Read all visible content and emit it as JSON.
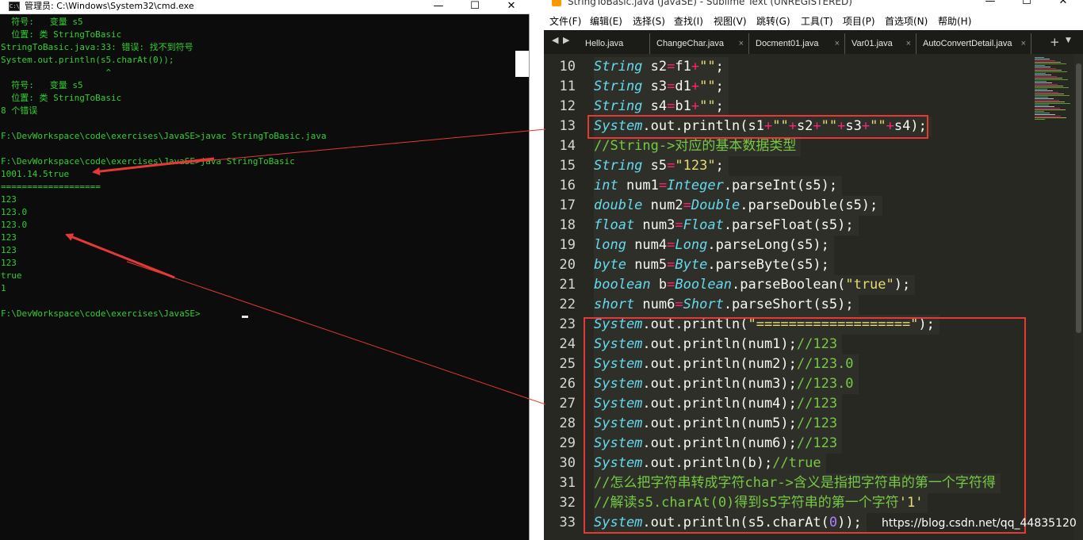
{
  "cmd": {
    "title": "管理员: C:\\Windows\\System32\\cmd.exe",
    "icon": "cmd-icon",
    "minimize": "—",
    "maximize": "☐",
    "close": "✕",
    "lines": [
      "  符号:   变量 s5",
      "  位置: 类 StringToBasic",
      "StringToBasic.java:33: 错误: 找不到符号",
      "System.out.println(s5.charAt(0));",
      "                    ^",
      "  符号:   变量 s5",
      "  位置: 类 StringToBasic",
      "8 个错误",
      "",
      "F:\\DevWorkspace\\code\\exercises\\JavaSE>javac StringToBasic.java",
      "",
      "F:\\DevWorkspace\\code\\exercises\\JavaSE>java StringToBasic",
      "1001.14.5true",
      "===================",
      "123",
      "123.0",
      "123.0",
      "123",
      "123",
      "123",
      "true",
      "1",
      "",
      "F:\\DevWorkspace\\code\\exercises\\JavaSE>"
    ]
  },
  "sublime": {
    "title": "StringToBasic.java (JavaSE) - Sublime Text (UNREGISTERED)",
    "minimize": "—",
    "maximize": "☐",
    "close": "✕",
    "menu": [
      "文件(F)",
      "编辑(E)",
      "选择(S)",
      "查找(I)",
      "视图(V)",
      "跳转(G)",
      "工具(T)",
      "项目(P)",
      "首选项(N)",
      "帮助(H)"
    ],
    "tab_nav": [
      "◀",
      "▶"
    ],
    "tabs": [
      "Hello.java",
      "ChangeChar.java",
      "Docment01.java",
      "Var01.java",
      "AutoConvertDetail.java"
    ],
    "tab_close": "×",
    "tab_plus": "+",
    "tab_more": "▼",
    "code": [
      {
        "n": "10",
        "tokens": [
          [
            "type",
            "String"
          ],
          [
            "plain",
            " s2"
          ],
          [
            "op",
            "="
          ],
          [
            "plain",
            "f1"
          ],
          [
            "op",
            "+"
          ],
          [
            "str",
            "\"\""
          ],
          [
            "plain",
            ";"
          ]
        ]
      },
      {
        "n": "11",
        "tokens": [
          [
            "type",
            "String"
          ],
          [
            "plain",
            " s3"
          ],
          [
            "op",
            "="
          ],
          [
            "plain",
            "d1"
          ],
          [
            "op",
            "+"
          ],
          [
            "str",
            "\"\""
          ],
          [
            "plain",
            ";"
          ]
        ]
      },
      {
        "n": "12",
        "tokens": [
          [
            "type",
            "String"
          ],
          [
            "plain",
            " s4"
          ],
          [
            "op",
            "="
          ],
          [
            "plain",
            "b1"
          ],
          [
            "op",
            "+"
          ],
          [
            "str",
            "\"\""
          ],
          [
            "plain",
            ";"
          ]
        ]
      },
      {
        "n": "13",
        "tokens": [
          [
            "type",
            "System"
          ],
          [
            "plain",
            ".out.println(s1"
          ],
          [
            "op",
            "+"
          ],
          [
            "str",
            "\"\""
          ],
          [
            "op",
            "+"
          ],
          [
            "plain",
            "s2"
          ],
          [
            "op",
            "+"
          ],
          [
            "str",
            "\"\""
          ],
          [
            "op",
            "+"
          ],
          [
            "plain",
            "s3"
          ],
          [
            "op",
            "+"
          ],
          [
            "str",
            "\"\""
          ],
          [
            "op",
            "+"
          ],
          [
            "plain",
            "s4);"
          ]
        ]
      },
      {
        "n": "14",
        "tokens": [
          [
            "cmt",
            "//String->对应的基本数据类型"
          ]
        ]
      },
      {
        "n": "15",
        "tokens": [
          [
            "type",
            "String"
          ],
          [
            "plain",
            " s5"
          ],
          [
            "op",
            "="
          ],
          [
            "str",
            "\"123\""
          ],
          [
            "plain",
            ";"
          ]
        ]
      },
      {
        "n": "16",
        "tokens": [
          [
            "type",
            "int"
          ],
          [
            "plain",
            " num1"
          ],
          [
            "op",
            "="
          ],
          [
            "type",
            "Integer"
          ],
          [
            "plain",
            ".parseInt(s5);"
          ]
        ]
      },
      {
        "n": "17",
        "tokens": [
          [
            "type",
            "double"
          ],
          [
            "plain",
            " num2"
          ],
          [
            "op",
            "="
          ],
          [
            "type",
            "Double"
          ],
          [
            "plain",
            ".parseDouble(s5);"
          ]
        ]
      },
      {
        "n": "18",
        "tokens": [
          [
            "type",
            "float"
          ],
          [
            "plain",
            " num3"
          ],
          [
            "op",
            "="
          ],
          [
            "type",
            "Float"
          ],
          [
            "plain",
            ".parseFloat(s5);"
          ]
        ]
      },
      {
        "n": "19",
        "tokens": [
          [
            "type",
            "long"
          ],
          [
            "plain",
            " num4"
          ],
          [
            "op",
            "="
          ],
          [
            "type",
            "Long"
          ],
          [
            "plain",
            ".parseLong(s5);"
          ]
        ]
      },
      {
        "n": "20",
        "tokens": [
          [
            "type",
            "byte"
          ],
          [
            "plain",
            " num5"
          ],
          [
            "op",
            "="
          ],
          [
            "type",
            "Byte"
          ],
          [
            "plain",
            ".parseByte(s5);"
          ]
        ]
      },
      {
        "n": "21",
        "tokens": [
          [
            "type",
            "boolean"
          ],
          [
            "plain",
            " b"
          ],
          [
            "op",
            "="
          ],
          [
            "type",
            "Boolean"
          ],
          [
            "plain",
            ".parseBoolean("
          ],
          [
            "str",
            "\"true\""
          ],
          [
            "plain",
            ");"
          ]
        ]
      },
      {
        "n": "22",
        "tokens": [
          [
            "type",
            "short"
          ],
          [
            "plain",
            " num6"
          ],
          [
            "op",
            "="
          ],
          [
            "type",
            "Short"
          ],
          [
            "plain",
            ".parseShort(s5);"
          ]
        ]
      },
      {
        "n": "23",
        "tokens": [
          [
            "type",
            "System"
          ],
          [
            "plain",
            ".out.println("
          ],
          [
            "str",
            "\"===================\""
          ],
          [
            "plain",
            ");"
          ]
        ]
      },
      {
        "n": "24",
        "tokens": [
          [
            "type",
            "System"
          ],
          [
            "plain",
            ".out.println(num1);"
          ],
          [
            "cmt",
            "//123"
          ]
        ]
      },
      {
        "n": "25",
        "tokens": [
          [
            "type",
            "System"
          ],
          [
            "plain",
            ".out.println(num2);"
          ],
          [
            "cmt",
            "//123.0"
          ]
        ]
      },
      {
        "n": "26",
        "tokens": [
          [
            "type",
            "System"
          ],
          [
            "plain",
            ".out.println(num3);"
          ],
          [
            "cmt",
            "//123.0"
          ]
        ]
      },
      {
        "n": "27",
        "tokens": [
          [
            "type",
            "System"
          ],
          [
            "plain",
            ".out.println(num4);"
          ],
          [
            "cmt",
            "//123"
          ]
        ]
      },
      {
        "n": "28",
        "tokens": [
          [
            "type",
            "System"
          ],
          [
            "plain",
            ".out.println(num5);"
          ],
          [
            "cmt",
            "//123"
          ]
        ]
      },
      {
        "n": "29",
        "tokens": [
          [
            "type",
            "System"
          ],
          [
            "plain",
            ".out.println(num6);"
          ],
          [
            "cmt",
            "//123"
          ]
        ]
      },
      {
        "n": "30",
        "tokens": [
          [
            "type",
            "System"
          ],
          [
            "plain",
            ".out.println(b);"
          ],
          [
            "cmt",
            "//true"
          ]
        ]
      },
      {
        "n": "31",
        "tokens": [
          [
            "cmt",
            "//怎么把字符串转成字符char->含义是指把字符串的第一个字符得"
          ]
        ]
      },
      {
        "n": "32",
        "tokens": [
          [
            "cmt",
            "//解读s5.charAt(0)得到s5字符串的第一个字符"
          ],
          [
            "str",
            "'1'"
          ]
        ]
      },
      {
        "n": "33",
        "tokens": [
          [
            "type",
            "System"
          ],
          [
            "plain",
            ".out.println(s5.charAt("
          ],
          [
            "num",
            "0"
          ],
          [
            "plain",
            "));"
          ]
        ]
      }
    ]
  },
  "watermark": "https://blog.csdn.net/qq_44835120",
  "colors": {
    "annotation": "#e53935",
    "cmd_text": "#2fd02f",
    "editor_bg": "#272822"
  }
}
